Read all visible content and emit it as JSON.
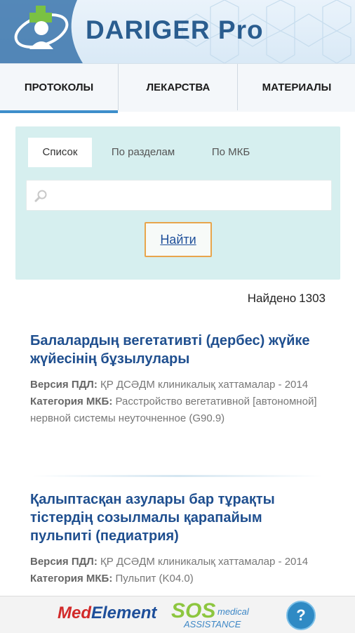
{
  "header": {
    "app_title": "DARIGER Pro"
  },
  "tabs": [
    {
      "label": "ПРОТОКОЛЫ",
      "active": true
    },
    {
      "label": "ЛЕКАРСТВА",
      "active": false
    },
    {
      "label": "МАТЕРИАЛЫ",
      "active": false
    }
  ],
  "search": {
    "subtabs": [
      {
        "label": "Список",
        "active": true
      },
      {
        "label": "По разделам",
        "active": false
      },
      {
        "label": "По МКБ",
        "active": false
      }
    ],
    "query": "",
    "find_label": "Найти",
    "icon": "search-icon"
  },
  "found": {
    "label": "Найдено",
    "count": "1303"
  },
  "results": [
    {
      "title": "Балалардың вегетативті (дербес) жүйке жүйесінің бұзылулары",
      "version_label": "Версия ПДЛ:",
      "version_value": "ҚР ДСӘДМ клиникалық хаттамалар - 2014",
      "category_label": "Категория МКБ:",
      "category_value": "Расстройство вегетативной [автономной] нервной системы неуточненное (G90.9)"
    },
    {
      "title": "Қалыптасқан азулары бар тұрақты тістердің созылмалы қарапайым пульпиті (педиатрия)",
      "version_label": "Версия ПДЛ:",
      "version_value": "ҚР ДСӘДМ клиникалық хаттамалар - 2014",
      "category_label": "Категория МКБ:",
      "category_value": "Пульпит (K04.0)"
    }
  ],
  "footer": {
    "medelement_a": "Med",
    "medelement_b": "Element",
    "sos_big": "SOS",
    "sos_small1": "medical",
    "sos_small2": "ASSISTANCE",
    "help_label": "?"
  },
  "colors": {
    "accent": "#3d8ecb",
    "panel": "#d6efef",
    "title": "#1f4f8f",
    "button_border": "#e8a54c"
  }
}
